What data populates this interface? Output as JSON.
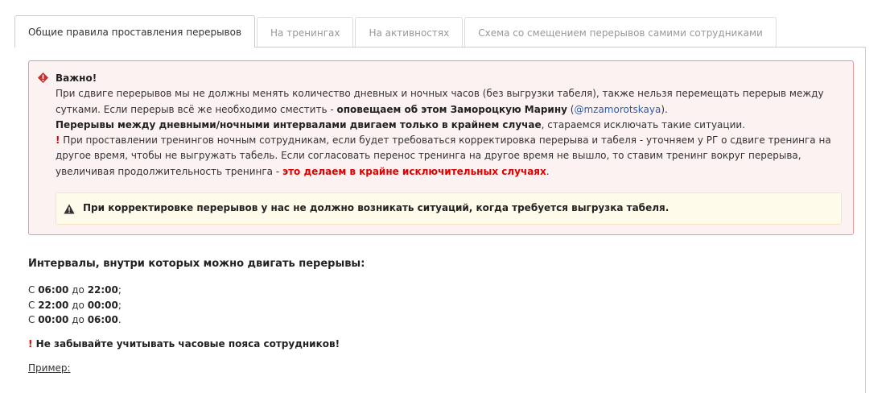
{
  "tabs": [
    {
      "label": "Общие правила проставления перерывов",
      "active": true
    },
    {
      "label": "На тренингах",
      "active": false
    },
    {
      "label": "На активностях",
      "active": false
    },
    {
      "label": "Схема со смещением перерывов самими сотрудниками",
      "active": false
    }
  ],
  "alert": {
    "icon": "error-icon",
    "title": "Важно!",
    "p1_text": "При сдвиге перерывов мы не должны менять количество дневных и ночных часов (без выгрузки табеля), также нельзя перемещать перерыв между сутками. Если перерыв всё же необходимо сместить - ",
    "p1_bold": "оповещаем об этом Замороцкую Марину",
    "p1_paren_open": " (",
    "p1_link": "@mzamorotskaya",
    "p1_paren_close": ").",
    "p2_bold": "Перерывы между дневными/ночными интервалами двигаем только в крайнем случае",
    "p2_text": ", стараемся исключать такие ситуации.",
    "p3_bang": "!",
    "p3_text": " При проставлении тренингов ночным сотрудникам, если будет требоваться корректировка перерыва и табеля - уточняем у РГ о сдвиге тренинга на другое время, чтобы не выгружать табель. Если согласовать перенос тренинга на другое время не вышло, то ставим тренинг вокруг перерыва, увеличивая продолжительность тренинга - ",
    "p3_red": "это делаем в крайне исключительных случаях",
    "p3_end": ".",
    "warning_icon": "warning-icon",
    "warning": "При корректировке перерывов у нас не должно возникать ситуаций, когда требуется выгрузка табеля."
  },
  "intervals": {
    "heading": "Интервалы, внутри которых можно двигать перерывы:",
    "items": [
      {
        "from_word": "С ",
        "from": "06:00",
        "to_word": " до ",
        "to": "22:00",
        "end": ";"
      },
      {
        "from_word": "С ",
        "from": "22:00",
        "to_word": " до ",
        "to": "00:00",
        "end": ";"
      },
      {
        "from_word": "С ",
        "from": "00:00",
        "to_word": " до ",
        "to": "06:00",
        "end": "."
      }
    ],
    "note_bang": "!",
    "note": " Не забывайте учитывать часовые пояса сотрудников!",
    "example": "Пример:"
  },
  "colors": {
    "alert_bg": "#fdf2f2",
    "alert_border": "#e19b9b",
    "warning_bg": "#fffbea",
    "accent_red": "#e00000",
    "link": "#2a5db0"
  }
}
